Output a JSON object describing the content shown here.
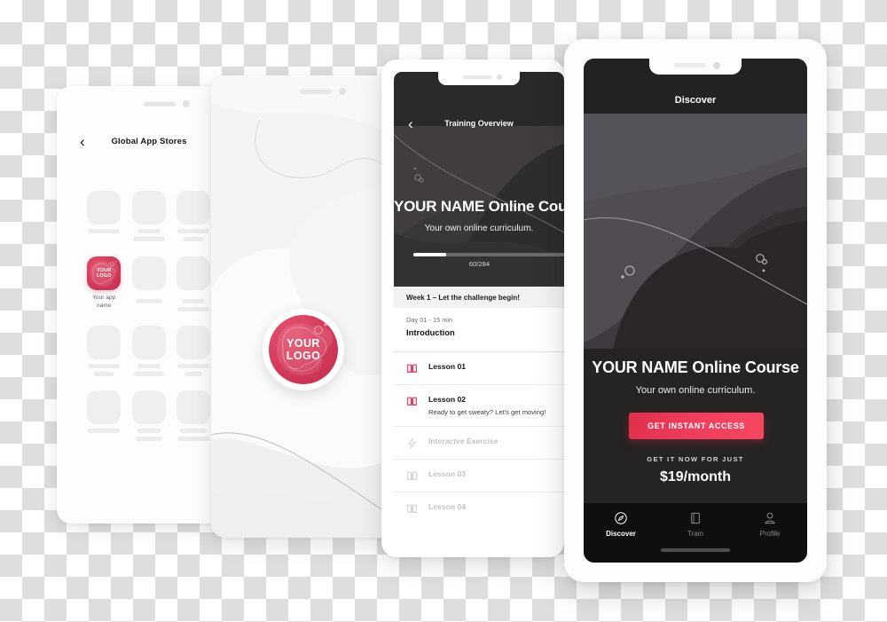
{
  "scene": {
    "title": "Mobile app mockup showcase — four phone screens",
    "accent_color": "#e63a5c",
    "dark_color": "#262323",
    "background": "transparent-checkerboard"
  },
  "phone1": {
    "name": "Global App Stores listing",
    "back_icon": "chevron-left-icon",
    "header_title": "Global App Stores",
    "highlight_app": {
      "logo_line1": "YOUR",
      "logo_line2": "LOGO",
      "app_name": "Your app\nname"
    },
    "placeholder_count": 11
  },
  "phone2": {
    "name": "Splash / branding screen",
    "logo_line1": "YOUR",
    "logo_line2": "LOGO"
  },
  "phone3": {
    "name": "Training Overview",
    "back_icon": "chevron-left-icon",
    "header_title": "Training Overview",
    "hero_title": "YOUR NAME Online Course",
    "hero_subtitle": "Your own online curriculum.",
    "progress": {
      "label": "60/284",
      "current": 60,
      "total": 284,
      "percent": 21
    },
    "week_label": "Week 1  –  Let the challenge begin!",
    "day_meta": "Day 01 - 15 min",
    "day_title": "Introduction",
    "lessons": [
      {
        "title": "Lesson 01",
        "subtitle": "",
        "icon": "book-icon",
        "state": "active"
      },
      {
        "title": "Lesson 02",
        "subtitle": "Ready to get sweaty? Let's get moving!",
        "icon": "book-icon",
        "state": "active"
      },
      {
        "title": "Interactve Exercise",
        "subtitle": "",
        "icon": "lightning-icon",
        "state": "locked"
      },
      {
        "title": "Lesson 03",
        "subtitle": "",
        "icon": "book-icon",
        "state": "locked"
      },
      {
        "title": "Lesson 04",
        "subtitle": "",
        "icon": "book-icon",
        "state": "locked"
      }
    ]
  },
  "phone4": {
    "name": "Discover / paywall screen",
    "header_title": "Discover",
    "title": "YOUR NAME Online Course",
    "subtitle": "Your own online curriculum.",
    "cta_label": "GET INSTANT ACCESS",
    "price_eyebrow": "GET IT NOW FOR JUST",
    "price": "$19/month",
    "nav": [
      {
        "label": "Discover",
        "icon": "compass-icon",
        "active": true
      },
      {
        "label": "Train",
        "icon": "book-closed-icon",
        "active": false
      },
      {
        "label": "Profile",
        "icon": "person-icon",
        "active": false
      }
    ]
  }
}
